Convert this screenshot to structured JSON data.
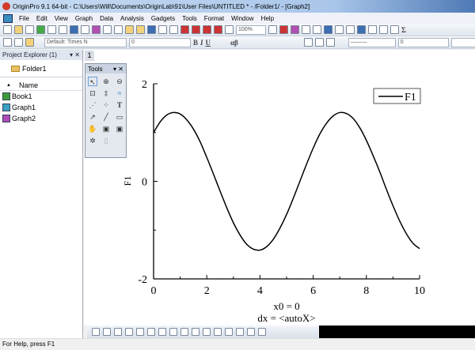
{
  "window": {
    "title": "OriginPro 9.1 64-bit - C:\\Users\\Will\\Documents\\OriginLab\\91\\User Files\\UNTITLED * - /Folder1/ - [Graph2]"
  },
  "menu": [
    "File",
    "Edit",
    "View",
    "Graph",
    "Data",
    "Analysis",
    "Gadgets",
    "Tools",
    "Format",
    "Window",
    "Help"
  ],
  "toolbar": {
    "zoom": "100%",
    "font": "Default: Times N",
    "font_size": "0",
    "line_width": "0",
    "bold": "B",
    "italic": "I",
    "underline": "U",
    "greek": "αβ",
    "sum": "Σ"
  },
  "project_explorer": {
    "title": "Project Explorer (1)",
    "folder": "Folder1",
    "column": "Name",
    "items": [
      {
        "label": "Book1",
        "icon": "workbook-icon"
      },
      {
        "label": "Graph1",
        "icon": "graph-icon"
      },
      {
        "label": "Graph2",
        "icon": "graph-icon"
      }
    ]
  },
  "graph_tab": "1",
  "tools_palette": {
    "title": "Tools",
    "text_tool": "T"
  },
  "status": "For Help, press F1",
  "chart_data": {
    "type": "line",
    "x": [
      0,
      0.25,
      0.5,
      0.75,
      1,
      1.25,
      1.5,
      1.75,
      2,
      2.25,
      2.5,
      2.75,
      3,
      3.25,
      3.5,
      3.75,
      4,
      4.25,
      4.5,
      4.75,
      5,
      5.25,
      5.5,
      5.75,
      6,
      6.25,
      6.5,
      6.75,
      7,
      7.25,
      7.5,
      7.75,
      8,
      8.25,
      8.5,
      8.75,
      9,
      9.25,
      9.5,
      9.75,
      10
    ],
    "series": [
      {
        "name": "F1",
        "values": [
          1.0,
          1.22,
          1.36,
          1.41,
          1.38,
          1.26,
          1.07,
          0.81,
          0.49,
          0.15,
          -0.2,
          -0.54,
          -0.85,
          -1.1,
          -1.29,
          -1.39,
          -1.41,
          -1.34,
          -1.19,
          -0.96,
          -0.68,
          -0.35,
          0.0,
          0.35,
          0.68,
          0.97,
          1.19,
          1.34,
          1.41,
          1.39,
          1.29,
          1.1,
          0.84,
          0.53,
          0.2,
          -0.16,
          -0.5,
          -0.81,
          -1.07,
          -1.27,
          -1.38
        ]
      }
    ],
    "xlim": [
      0,
      10
    ],
    "ylim": [
      -2,
      2
    ],
    "xticks": [
      "0",
      "2",
      "4",
      "6",
      "8",
      "10"
    ],
    "yticks": [
      "-2",
      "0",
      "2"
    ],
    "ylabel": "F1",
    "xlabel_lines": [
      "x0 = 0",
      "dx = <autoX>"
    ],
    "legend": "top-right",
    "grid": false,
    "line_color": "#000000"
  }
}
